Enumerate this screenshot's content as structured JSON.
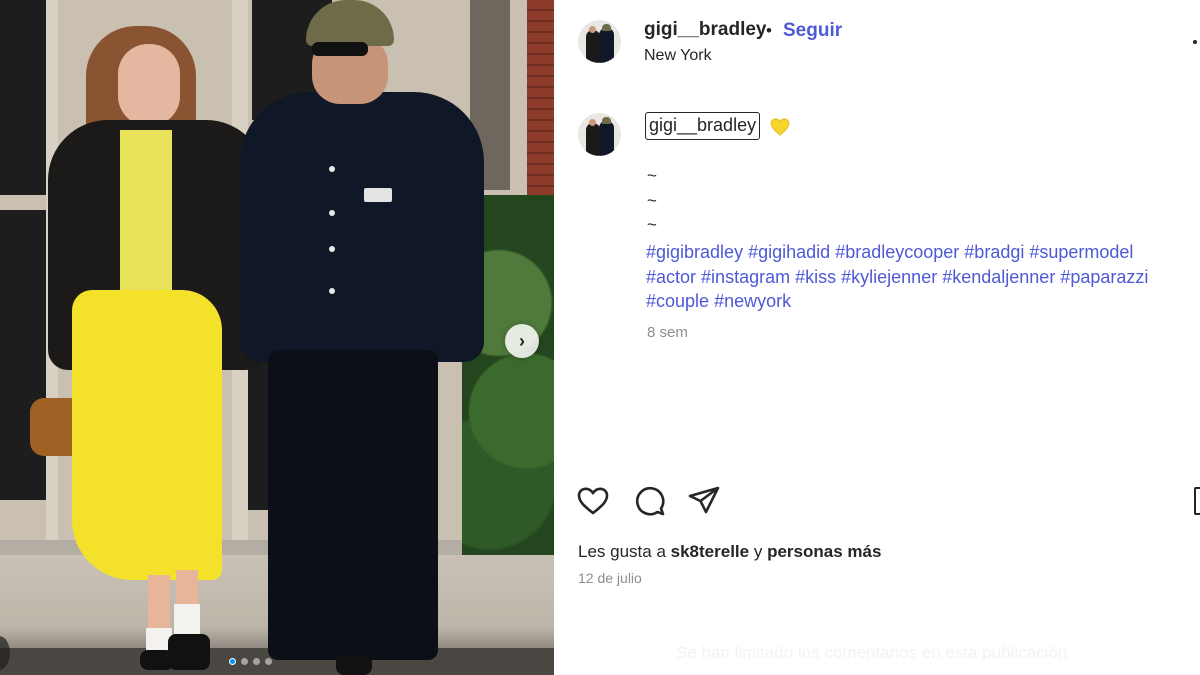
{
  "post": {
    "photo": {
      "description_icon": "photo-carousel",
      "slide_count": 4,
      "current_slide": 1
    },
    "header": {
      "username": "gigi__bradley",
      "separator": "•",
      "follow_label": "Seguir",
      "location": "New York"
    },
    "caption": {
      "username": "gigi__bradley",
      "emoji": "yellow-heart",
      "lines": [
        "~",
        "~",
        "~"
      ],
      "hashtags": [
        "#gigibradley",
        "#gigihadid",
        "#bradleycooper",
        "#bradgi",
        "#supermodel",
        "#actor",
        "#instagram",
        "#kiss",
        "#kyliejenner",
        "#kendaljenner",
        "#paparazzi",
        "#couple",
        "#newyork"
      ],
      "time_ago": "8 sem"
    },
    "actions": {
      "like_icon": "heart-icon",
      "comment_icon": "comment-icon",
      "share_icon": "send-icon",
      "save_icon": "bookmark-icon"
    },
    "likes": {
      "prefix": "Les gusta a",
      "user": "sk8terelle",
      "connector": "y",
      "others": "personas más"
    },
    "date": "12 de julio",
    "comments_notice": "Se han limitado los comentarios en esta publicación"
  },
  "colors": {
    "link_blue": "#4e59d6",
    "text": "#262626",
    "muted": "#8e8e8e",
    "carousel_active": "#0095f6"
  }
}
